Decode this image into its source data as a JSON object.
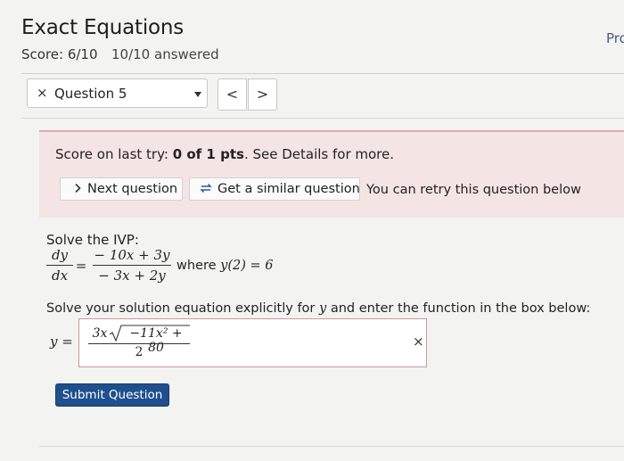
{
  "header": {
    "title": "Exact Equations",
    "score": "Score: 6/10",
    "answered": "10/10 answered",
    "cut_label": "Pro"
  },
  "question_nav": {
    "close_glyph": "×",
    "selected": "Question 5",
    "prev_glyph": "<",
    "next_glyph": ">"
  },
  "banner": {
    "prefix": "Score on last try: ",
    "score_bold": "0 of 1 pts",
    "suffix": ". See Details for more.",
    "next_button": "Next question",
    "similar_button": "Get a similar question",
    "retry_text": "You can retry this question below"
  },
  "problem": {
    "intro": "Solve the IVP:",
    "lhs_num": "dy",
    "lhs_den": "dx",
    "equals": "=",
    "rhs_num": "− 10x + 3y",
    "rhs_den": "− 3x + 2y",
    "where_text": "where",
    "condition": "y(2) = 6",
    "instruction_prefix": "Solve your solution equation explicitly for ",
    "instruction_var": "y",
    "instruction_suffix": " and enter the function in the box below:"
  },
  "answer": {
    "lhs": "y =",
    "num_coef": "3x",
    "radicand": "−11x² + 80",
    "den": "2",
    "clear_glyph": "×"
  },
  "submit_label": "Submit Question",
  "colors": {
    "banner_bg": "#f4e4e4",
    "banner_accent": "#e4a9a9",
    "submit_bg": "#1f4f8c",
    "answer_border": "#c99a9a"
  },
  "icons": {
    "next": "chevron-right-icon",
    "similar": "refresh-icon",
    "clear": "close-icon",
    "dropdown": "caret-down-icon"
  }
}
